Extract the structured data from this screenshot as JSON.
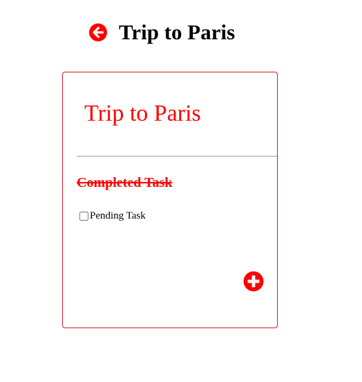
{
  "header": {
    "title": "Trip to Paris",
    "back_icon": "arrow-circle-left-icon",
    "accent_color": "#ff0000"
  },
  "card": {
    "title": "Trip to Paris",
    "border_color": "#e0102a",
    "completed_tasks": [
      {
        "label": "Completed Task",
        "done": true
      }
    ],
    "pending_tasks": [
      {
        "label": "Pending Task",
        "done": false
      }
    ],
    "add_icon": "plus-circle-icon"
  }
}
